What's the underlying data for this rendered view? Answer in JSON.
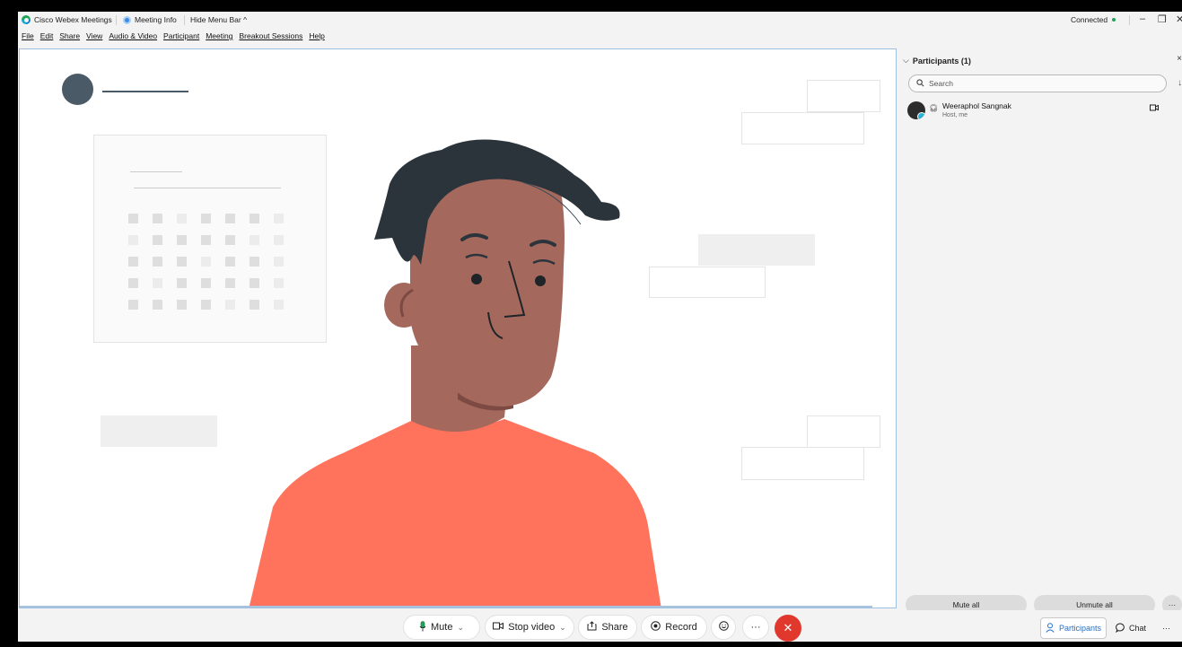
{
  "titlebar": {
    "app_name": "Cisco Webex Meetings",
    "meeting_info": "Meeting Info",
    "hide_menu": "Hide Menu Bar",
    "hide_caret": "^",
    "status": "Connected",
    "minimize": "–",
    "restore": "❐",
    "close": "✕"
  },
  "menu": [
    "File",
    "Edit",
    "Share",
    "View",
    "Audio & Video",
    "Participant",
    "Meeting",
    "Breakout Sessions",
    "Help"
  ],
  "panel": {
    "title": "Participants (1)",
    "collapse": "⌵",
    "close": "×",
    "search_placeholder": "Search",
    "participant": {
      "name": "Weeraphol Sangnak",
      "role": "Host, me"
    },
    "mute_all": "Mute all",
    "unmute_all": "Unmute all",
    "more": "···"
  },
  "controls": {
    "mute": "Mute",
    "stop_video": "Stop video",
    "share": "Share",
    "record": "Record",
    "more": "···",
    "end": "✕",
    "participants": "Participants",
    "chat": "Chat",
    "panel_more": "···"
  },
  "colors": {
    "accent": "#1f6fc5",
    "end_call": "#e0382d",
    "shirt": "#ff735c",
    "skin": "#a4685d",
    "hair": "#2b343b",
    "connected": "#1ea55b"
  }
}
